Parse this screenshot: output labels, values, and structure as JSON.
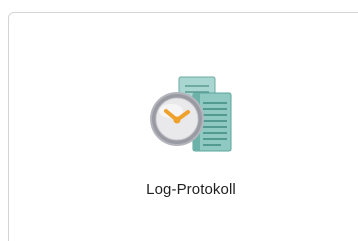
{
  "launcher": {
    "label": "Log-Protokoll",
    "icon": "log-protocol-icon"
  },
  "colors": {
    "panel_border": "#d4d4d4",
    "doc_teal": "#8fc9c2",
    "doc_teal_dark": "#5aa69c",
    "clock_face": "#e9e9ec",
    "clock_rim": "#9a9aa3",
    "clock_hand": "#f0a12b"
  }
}
